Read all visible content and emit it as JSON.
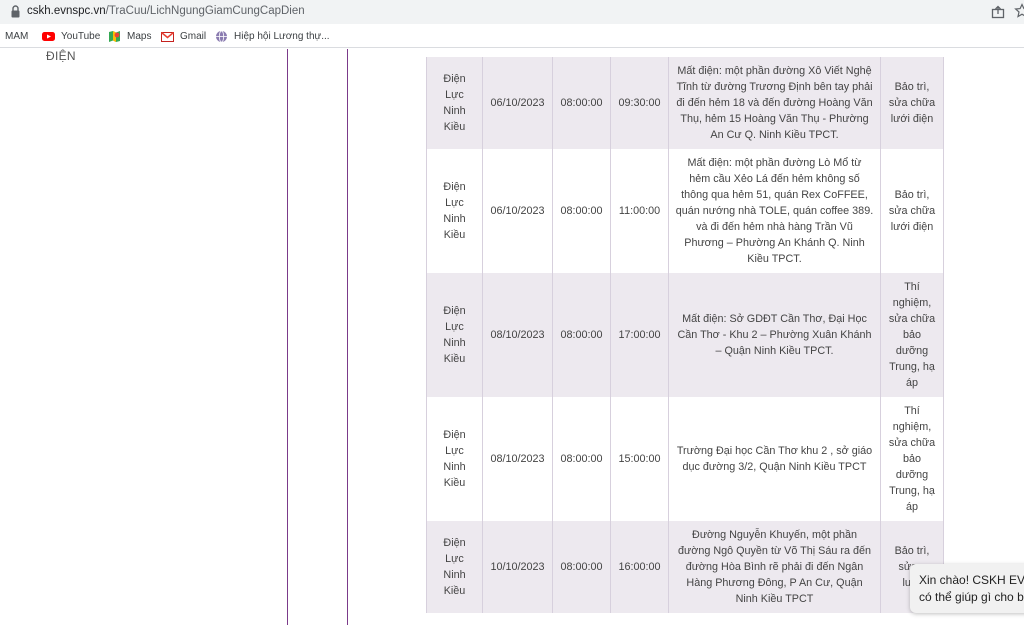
{
  "browser": {
    "url_host": "cskh.evnspc.vn",
    "url_path": "/TraCuu/LichNgungGiamCungCapDien",
    "bookmarks": [
      "MAM",
      "YouTube",
      "Maps",
      "Gmail",
      "Hiệp hội Lương thự..."
    ]
  },
  "page": {
    "left_label": "ĐIỆN"
  },
  "table": {
    "rows": [
      {
        "unit": [
          "Điện",
          "Lực",
          "Ninh",
          "Kiều"
        ],
        "date": "06/10/2023",
        "start": "08:00:00",
        "end": "09:30:00",
        "area": [
          "Mất điện: một phần đường Xô Viết Nghệ",
          "Tĩnh từ đường Trương Định bên tay phải",
          "đi đến hẻm 18 và đến đường Hoàng Văn",
          "Thụ, hẻm 15 Hoàng Văn Thụ - Phường",
          "An Cư Q. Ninh Kiều TPCT."
        ],
        "reason": [
          "Bảo trì,",
          "sửa chữa",
          "lưới điện"
        ]
      },
      {
        "unit": [
          "Điện",
          "Lực",
          "Ninh",
          "Kiều"
        ],
        "date": "06/10/2023",
        "start": "08:00:00",
        "end": "11:00:00",
        "area": [
          "Mất điện: một phần đường Lò Mổ từ",
          "hẻm cầu Xẻo Lá đến hẻm không số",
          "thông qua hẻm 51, quán Rex CoFFEE,",
          "quán nướng nhà TOLE, quán coffee 389.",
          "và đi đến hẻm nhà hàng Trần Vũ",
          "Phương – Phường An Khánh Q. Ninh",
          "Kiều TPCT."
        ],
        "reason": [
          "Bảo trì,",
          "sửa chữa",
          "lưới điện"
        ]
      },
      {
        "unit": [
          "Điện",
          "Lực",
          "Ninh",
          "Kiều"
        ],
        "date": "08/10/2023",
        "start": "08:00:00",
        "end": "17:00:00",
        "area": [
          "Mất điện: Sở GDĐT Cần Thơ, Đại Học",
          "Cần Thơ - Khu 2 – Phường Xuân Khánh",
          "– Quận Ninh Kiều TPCT."
        ],
        "reason": [
          "Thí",
          "nghiệm,",
          "sửa chữa",
          "bảo",
          "dưỡng",
          "Trung, hạ",
          "áp"
        ]
      },
      {
        "unit": [
          "Điện",
          "Lực",
          "Ninh",
          "Kiều"
        ],
        "date": "08/10/2023",
        "start": "08:00:00",
        "end": "15:00:00",
        "area": [
          "Trường Đại học Cần Thơ khu 2 , sở giáo",
          "dục đường 3/2, Quận Ninh Kiều TPCT"
        ],
        "reason": [
          "Thí",
          "nghiệm,",
          "sửa chữa",
          "bảo",
          "dưỡng",
          "Trung, hạ",
          "áp"
        ]
      },
      {
        "unit": [
          "Điện",
          "Lực",
          "Ninh",
          "Kiều"
        ],
        "date": "10/10/2023",
        "start": "08:00:00",
        "end": "16:00:00",
        "area": [
          "Đường Nguyễn Khuyến, một phần",
          "đường Ngô Quyền từ Võ Thị Sáu ra đến",
          "đường Hòa Bình rẽ phải đi đến Ngân",
          "Hàng Phương Đông, P An Cư, Quận",
          "Ninh Kiều TPCT"
        ],
        "reason": [
          "Bảo trì,",
          "sửa c",
          "lưới"
        ]
      }
    ]
  },
  "chat": {
    "line1": "Xin chào! CSKH EV",
    "line2": "có thể giúp gì cho b"
  }
}
